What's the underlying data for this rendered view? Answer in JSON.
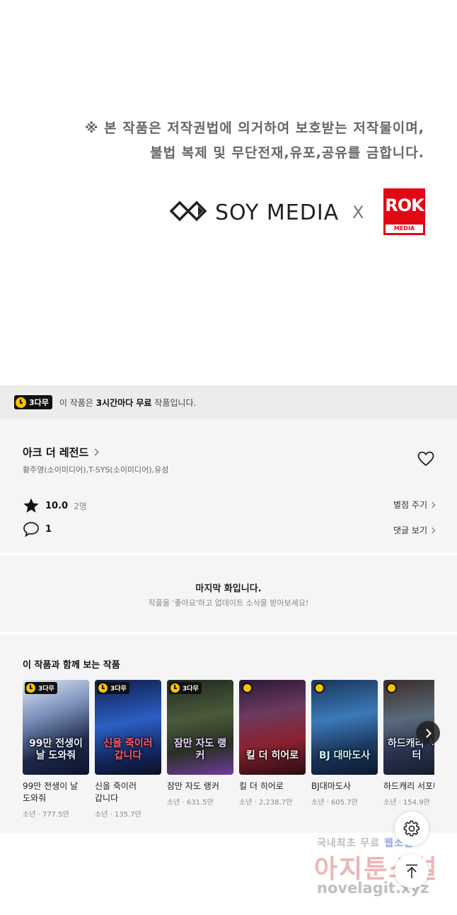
{
  "copyright": {
    "line1": "※ 본 작품은 저작권법에 의거하여 보호받는 저작물이며,",
    "line2": "불법 복제 및 무단전재,유포,공유를 금합니다.",
    "logo_left": "SOY MEDIA",
    "logo_sep": "X",
    "logo_right_big": "ROK",
    "logo_right_small": "MEDIA"
  },
  "free_notice": {
    "badge": "3다무",
    "text_pre": "이 작품은 ",
    "text_bold": "3시간마다 무료",
    "text_post": " 작품입니다."
  },
  "work": {
    "title": "아크 더 레전드",
    "authors": "황주영(소이미디어),T-SYS(소이미디어),유성",
    "rating": "10.0",
    "raters": "2명",
    "rate_link": "별점 주기",
    "comments": "1",
    "comment_link": "댓글 보기"
  },
  "last_episode": {
    "heading": "마지막 화입니다.",
    "sub": "작품을 '좋아요'하고 업데이트 소식을 받아보세요!"
  },
  "recommendations": {
    "title": "이 작품과 함께 보는 작품",
    "items": [
      {
        "name": "99만 전생이 날 도와줘",
        "meta": "소년 · 777.5만",
        "badge": "3다무",
        "art": "99만 전생이 날 도와줘"
      },
      {
        "name": "신을 죽이러 갑니다",
        "meta": "소년 · 135.7만",
        "badge": "3다무",
        "art": "신을 죽이러 갑니다"
      },
      {
        "name": "잠만 자도 랭커",
        "meta": "소년 · 631.5만",
        "badge": "3다무",
        "art": "잠만 자도 랭커"
      },
      {
        "name": "킬 더 히어로",
        "meta": "소년 · 2,238.7만",
        "badge": "",
        "art": "킬 더 히어로"
      },
      {
        "name": "BJ대마도사",
        "meta": "소년 · 605.7만",
        "badge": "",
        "art": "BJ 대마도사"
      },
      {
        "name": "하드캐리 서포터",
        "meta": "소년 · 154.9만",
        "badge": "",
        "art": "하드캐리 서포터"
      }
    ]
  },
  "icons": {
    "heart": "heart-icon",
    "star": "star-icon",
    "comment": "comment-icon",
    "settings": "gear-icon",
    "top": "arrow-up-icon",
    "next": "chevron-right-icon"
  },
  "watermark": {
    "line1a": "국내최초 무료 ",
    "line1b": "웹소설",
    "line2": "아지툰소설",
    "line3": "novelagit.xyz"
  },
  "colors": {
    "badge_yellow": "#f7c300",
    "panel_bg": "#f5f5f5",
    "notice_bg": "#ececec",
    "rok_red": "#e30613"
  }
}
